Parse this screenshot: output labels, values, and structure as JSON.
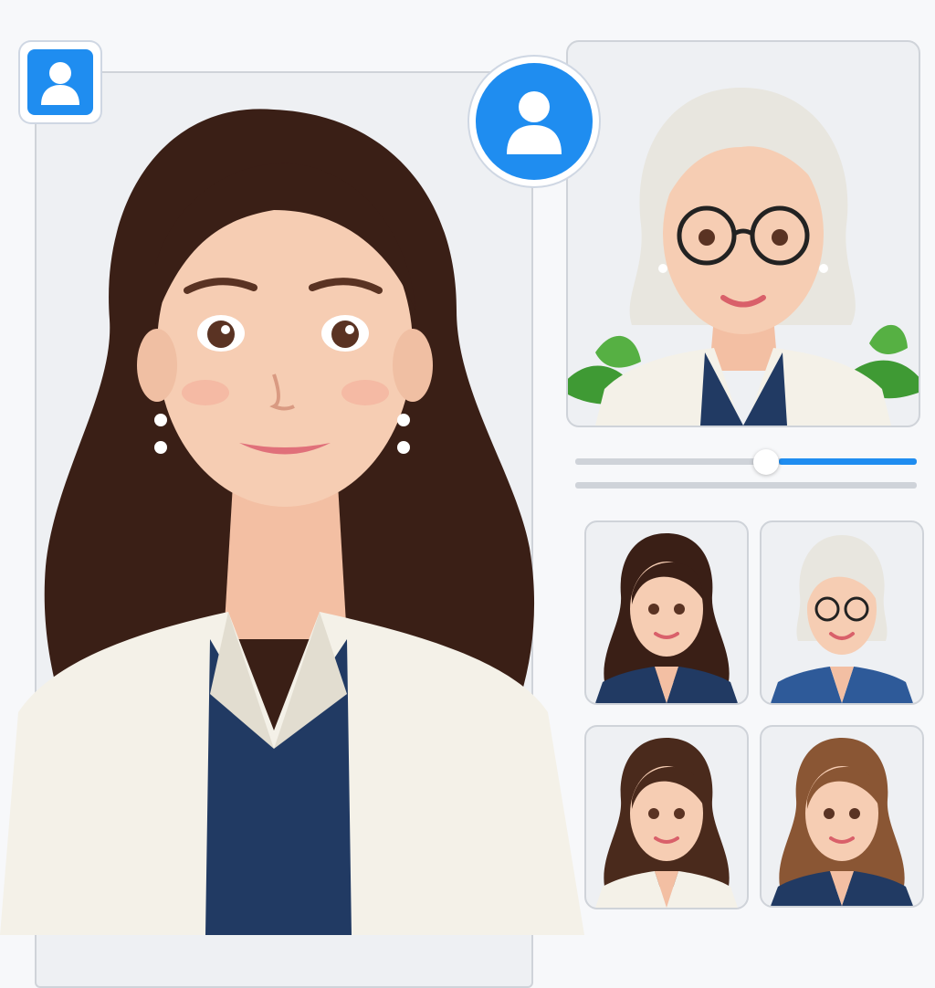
{
  "colors": {
    "accent": "#1f8df0",
    "panel_bg": "#eef0f3",
    "border": "#cfd3d9",
    "dark_hair": "#3a1f16",
    "white_hair": "#e8e6df",
    "brown_hair": "#8a5634",
    "jacket_white": "#f4f1e8",
    "jacket_navy": "#213a63",
    "skin": "#f6cdb3"
  },
  "icons": {
    "profile_square": "user-silhouette-icon",
    "profile_round": "user-silhouette-icon"
  },
  "portraits": {
    "main": {
      "hair": "dark-brown-long",
      "jacket": "white-blazer"
    },
    "preview": {
      "hair": "white-bob",
      "jacket": "white-blazer",
      "glasses": true,
      "decor": "leaves"
    },
    "thumbnails": [
      {
        "hair": "dark-brown-long",
        "jacket": "navy-blazer"
      },
      {
        "hair": "white-bob",
        "jacket": "navy-blazer",
        "glasses": true
      },
      {
        "hair": "dark-brown-long",
        "jacket": "white-blazer"
      },
      {
        "hair": "light-brown-long",
        "jacket": "navy-blazer"
      }
    ]
  },
  "slider": {
    "value": 0.56
  }
}
